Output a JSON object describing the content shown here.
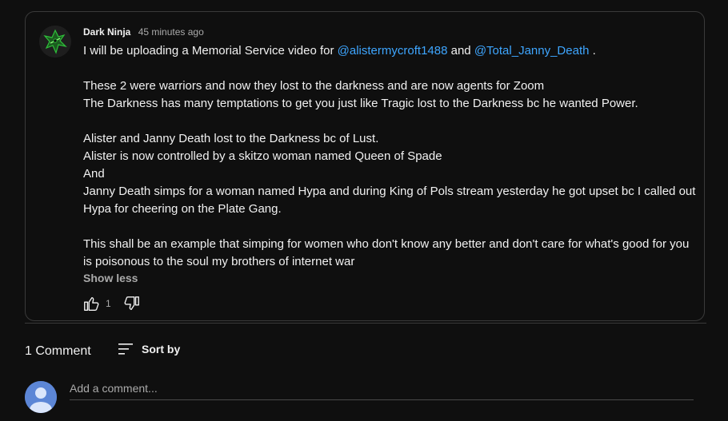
{
  "comment": {
    "author": "Dark Ninja",
    "time": "45 minutes ago",
    "line1_before": "I will be uploading a Memorial Service video for ",
    "mention1": "@alistermycroft1488",
    "line1_middle": " and ",
    "mention2": "@Total_Janny_Death",
    "line1_after": " .",
    "lines2": [
      "These 2 were warriors and now they lost to the darkness and are now agents for Zoom",
      "The Darkness has many temptations to get you just like Tragic lost to the Darkness bc he wanted Power."
    ],
    "lines3": [
      "Alister and Janny Death lost to the Darkness bc of Lust.",
      "Alister is now controlled by a skitzo woman named Queen of Spade",
      "And",
      "Janny Death simps for a woman named Hypa and during King of Pols stream yesterday he got upset bc I called out Hypa for cheering on the Plate Gang."
    ],
    "lines4": [
      "This shall be an example that simping for women who don't know any better and don't care for what's good for you is poisonous to the soul my brothers of internet war"
    ],
    "show_less": "Show less",
    "like_count": "1",
    "icons": {
      "like": "thumbs-up-icon",
      "dislike": "thumbs-down-icon"
    }
  },
  "comments_header": {
    "count_label": "1 Comment",
    "sort_label": "Sort by",
    "sort_icon": "sort-icon"
  },
  "add_comment": {
    "placeholder": "Add a comment..."
  },
  "colors": {
    "background": "#0f0f0f",
    "mention": "#3ea6ff",
    "avatar": "#5c86d6",
    "ninja_accent": "#2fbf3a"
  }
}
